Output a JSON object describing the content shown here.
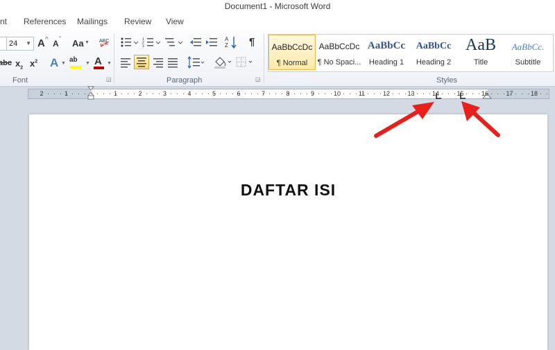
{
  "window": {
    "title": "Document1  -  Microsoft Word"
  },
  "tabs": [
    "nt",
    "References",
    "Mailings",
    "Review",
    "View"
  ],
  "font_group": {
    "label": "Font",
    "font_name_value": "",
    "font_size_value": "24",
    "grow_label": "A",
    "shrink_label": "A",
    "change_case_label": "Aa",
    "strike_label": "abc",
    "subscript_label": "x",
    "superscript_label": "x",
    "text_effects_label": "A",
    "highlight_label": "ab",
    "font_color_label": "A",
    "font_color": "#c00000",
    "highlight_color": "#ffff00"
  },
  "paragraph_group": {
    "label": "Paragraph",
    "sort_label": "A Z",
    "pilcrow_label": "¶"
  },
  "styles_group": {
    "label": "Styles",
    "items": [
      {
        "preview": "AaBbCcDc",
        "label": "¶ Normal",
        "selected": true
      },
      {
        "preview": "AaBbCcDc",
        "label": "¶ No Spaci...",
        "selected": false
      },
      {
        "preview": "AaBbCc",
        "label": "Heading 1",
        "selected": false
      },
      {
        "preview": "AaBbCc",
        "label": "Heading 2",
        "selected": false
      },
      {
        "preview": "AaB",
        "label": "Title",
        "selected": false
      },
      {
        "preview": "AaBbCc.",
        "label": "Subtitle",
        "selected": false
      }
    ],
    "heading_color": "#2f5597",
    "subtitle_color": "#4f81bd"
  },
  "ruler": {
    "numbers": [
      "2",
      "1",
      "1",
      "2",
      "3",
      "4",
      "5",
      "6",
      "7",
      "8",
      "9",
      "10",
      "11",
      "12",
      "13",
      "14",
      "15",
      "16",
      "17",
      "18"
    ]
  },
  "document": {
    "heading": "DAFTAR ISI"
  },
  "annotation": {
    "arrow_color": "#e8201b"
  }
}
